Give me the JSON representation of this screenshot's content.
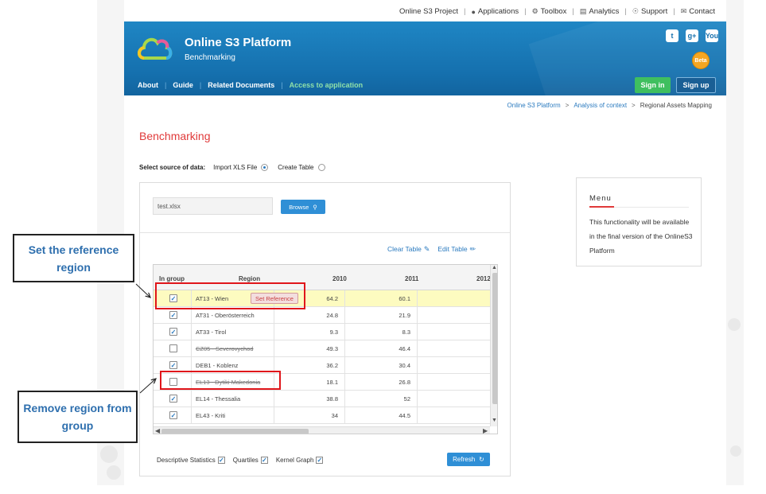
{
  "topnav": {
    "project": "Online S3 Project",
    "applications": "Applications",
    "toolbox": "Toolbox",
    "analytics": "Analytics",
    "support": "Support",
    "contact": "Contact"
  },
  "header": {
    "brand_title": "Online S3 Platform",
    "brand_subtitle": "Benchmarking",
    "beta_badge": "Beta",
    "social": [
      "t",
      "g+",
      "You"
    ],
    "nav": [
      "About",
      "Guide",
      "Related Documents",
      "Access to application"
    ],
    "sign_in": "Sign in",
    "sign_up": "Sign up"
  },
  "breadcrumb": [
    "Online S3 Platform",
    "Analysis of context",
    "Regional Assets Mapping"
  ],
  "page": {
    "title": "Benchmarking",
    "source_label": "Select source of data:",
    "option_import": "Import XLS File",
    "option_create": "Create Table"
  },
  "upload": {
    "file_value": "test.xlsx",
    "browse_label": "Browse"
  },
  "table_actions": {
    "clear": "Clear Table",
    "edit": "Edit Table"
  },
  "table": {
    "columns": [
      "In group",
      "Region",
      "2010",
      "2011",
      "2012"
    ],
    "set_reference_label": "Set Reference",
    "rows": [
      {
        "checked": true,
        "region": "AT13 - Wien",
        "v2010": "64.2",
        "v2011": "60.1",
        "strike": false,
        "highlight": true
      },
      {
        "checked": true,
        "region": "AT31 - Oberösterreich",
        "v2010": "24.8",
        "v2011": "21.9",
        "strike": false,
        "highlight": false
      },
      {
        "checked": true,
        "region": "AT33 - Tirol",
        "v2010": "9.3",
        "v2011": "8.3",
        "strike": false,
        "highlight": false
      },
      {
        "checked": false,
        "region": "CZ05 - Severovychod",
        "v2010": "49.3",
        "v2011": "46.4",
        "strike": true,
        "highlight": false
      },
      {
        "checked": true,
        "region": "DEB1 - Koblenz",
        "v2010": "36.2",
        "v2011": "30.4",
        "strike": false,
        "highlight": false
      },
      {
        "checked": false,
        "region": "EL13 - Dytiki Makedonia",
        "v2010": "18.1",
        "v2011": "26.8",
        "strike": true,
        "highlight": false
      },
      {
        "checked": true,
        "region": "EL14 - Thessalia",
        "v2010": "38.8",
        "v2011": "52",
        "strike": false,
        "highlight": false
      },
      {
        "checked": true,
        "region": "EL43 - Kriti",
        "v2010": "34",
        "v2011": "44.5",
        "strike": false,
        "highlight": false
      }
    ]
  },
  "options": {
    "descriptive": "Descriptive Statistics",
    "quartiles": "Quartiles",
    "kernel": "Kernel Graph",
    "refresh": "Refresh"
  },
  "menu": {
    "title": "Menu",
    "text": "This functionality will be available in the final version of the OnlineS3 Platform"
  },
  "callouts": {
    "reference": "Set the reference region",
    "remove": "Remove region from group"
  },
  "colors": {
    "banner": "#1570ae",
    "accent_red": "#e03a3a",
    "link_blue": "#2a7abf",
    "signin_green": "#3fbf5f",
    "annotation_red": "#e0161b"
  }
}
